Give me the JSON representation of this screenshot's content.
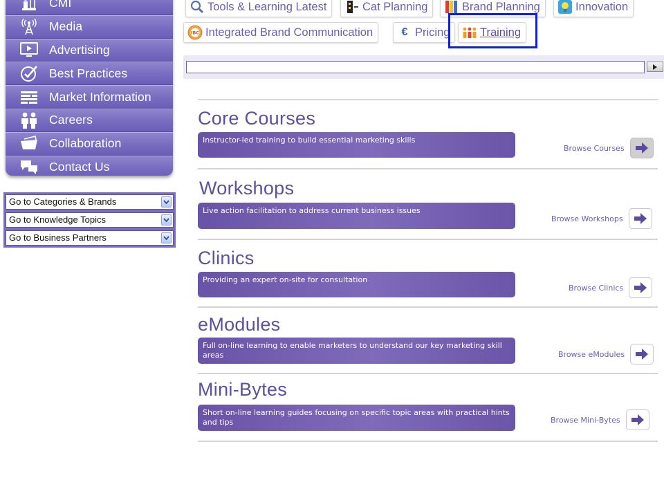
{
  "sidebar": {
    "items": [
      {
        "label": "CMI",
        "icon": "chess-pieces-icon"
      },
      {
        "label": "Media",
        "icon": "broadcast-tower-icon"
      },
      {
        "label": "Advertising",
        "icon": "monitor-play-icon"
      },
      {
        "label": "Best Practices",
        "icon": "checkmark-badge-icon"
      },
      {
        "label": "Market Information",
        "icon": "list-lines-icon"
      },
      {
        "label": "Careers",
        "icon": "people-icon"
      },
      {
        "label": "Collaboration",
        "icon": "folder-icon"
      },
      {
        "label": "Contact Us",
        "icon": "chat-bubbles-icon"
      }
    ]
  },
  "goto": {
    "options": [
      "Go to Categories & Brands",
      "Go to Knowledge Topics",
      "Go to Business Partners"
    ]
  },
  "tabs": {
    "row1": [
      {
        "label": "Tools & Learning Latest",
        "icon": "magnifier-icon"
      },
      {
        "label": "Cat Planning",
        "icon": "cat-planning-icon"
      },
      {
        "label": "Brand Planning",
        "icon": "color-bars-icon"
      },
      {
        "label": "Innovation",
        "icon": "lightbulb-icon"
      }
    ],
    "row2": [
      {
        "label": "Integrated Brand Communication",
        "icon": "ibc-badge-icon",
        "badge": "IBC"
      },
      {
        "label": "Pricing",
        "icon": "euro-icon",
        "symbol": "€"
      },
      {
        "label": "Training",
        "icon": "people-group-icon"
      }
    ],
    "active": "Training"
  },
  "search": {
    "value": ""
  },
  "sections": [
    {
      "title": "Core Courses",
      "description": "Instructor-led training to build essential marketing skills",
      "browse": "Browse Courses"
    },
    {
      "title": "Workshops",
      "description": "Live action facilitation to address current business issues",
      "browse": "Browse Workshops"
    },
    {
      "title": "Clinics",
      "description": "Providing an expert on-site for consultation",
      "browse": "Browse Clinics"
    },
    {
      "title": "eModules",
      "description": "Full on-line learning to enable marketers to understand our key marketing skill areas",
      "browse": "Browse eModules"
    },
    {
      "title": "Mini-Bytes",
      "description": "Short on-line learning guides focusing on specific topic areas with practical hints and tips",
      "browse": "Browse Mini-Bytes"
    }
  ],
  "colors": {
    "accent": "#6a5fae",
    "sidebar": "#7a6ec2",
    "highlight": "#0b1ee6",
    "arrow": "#5b4aa0"
  }
}
